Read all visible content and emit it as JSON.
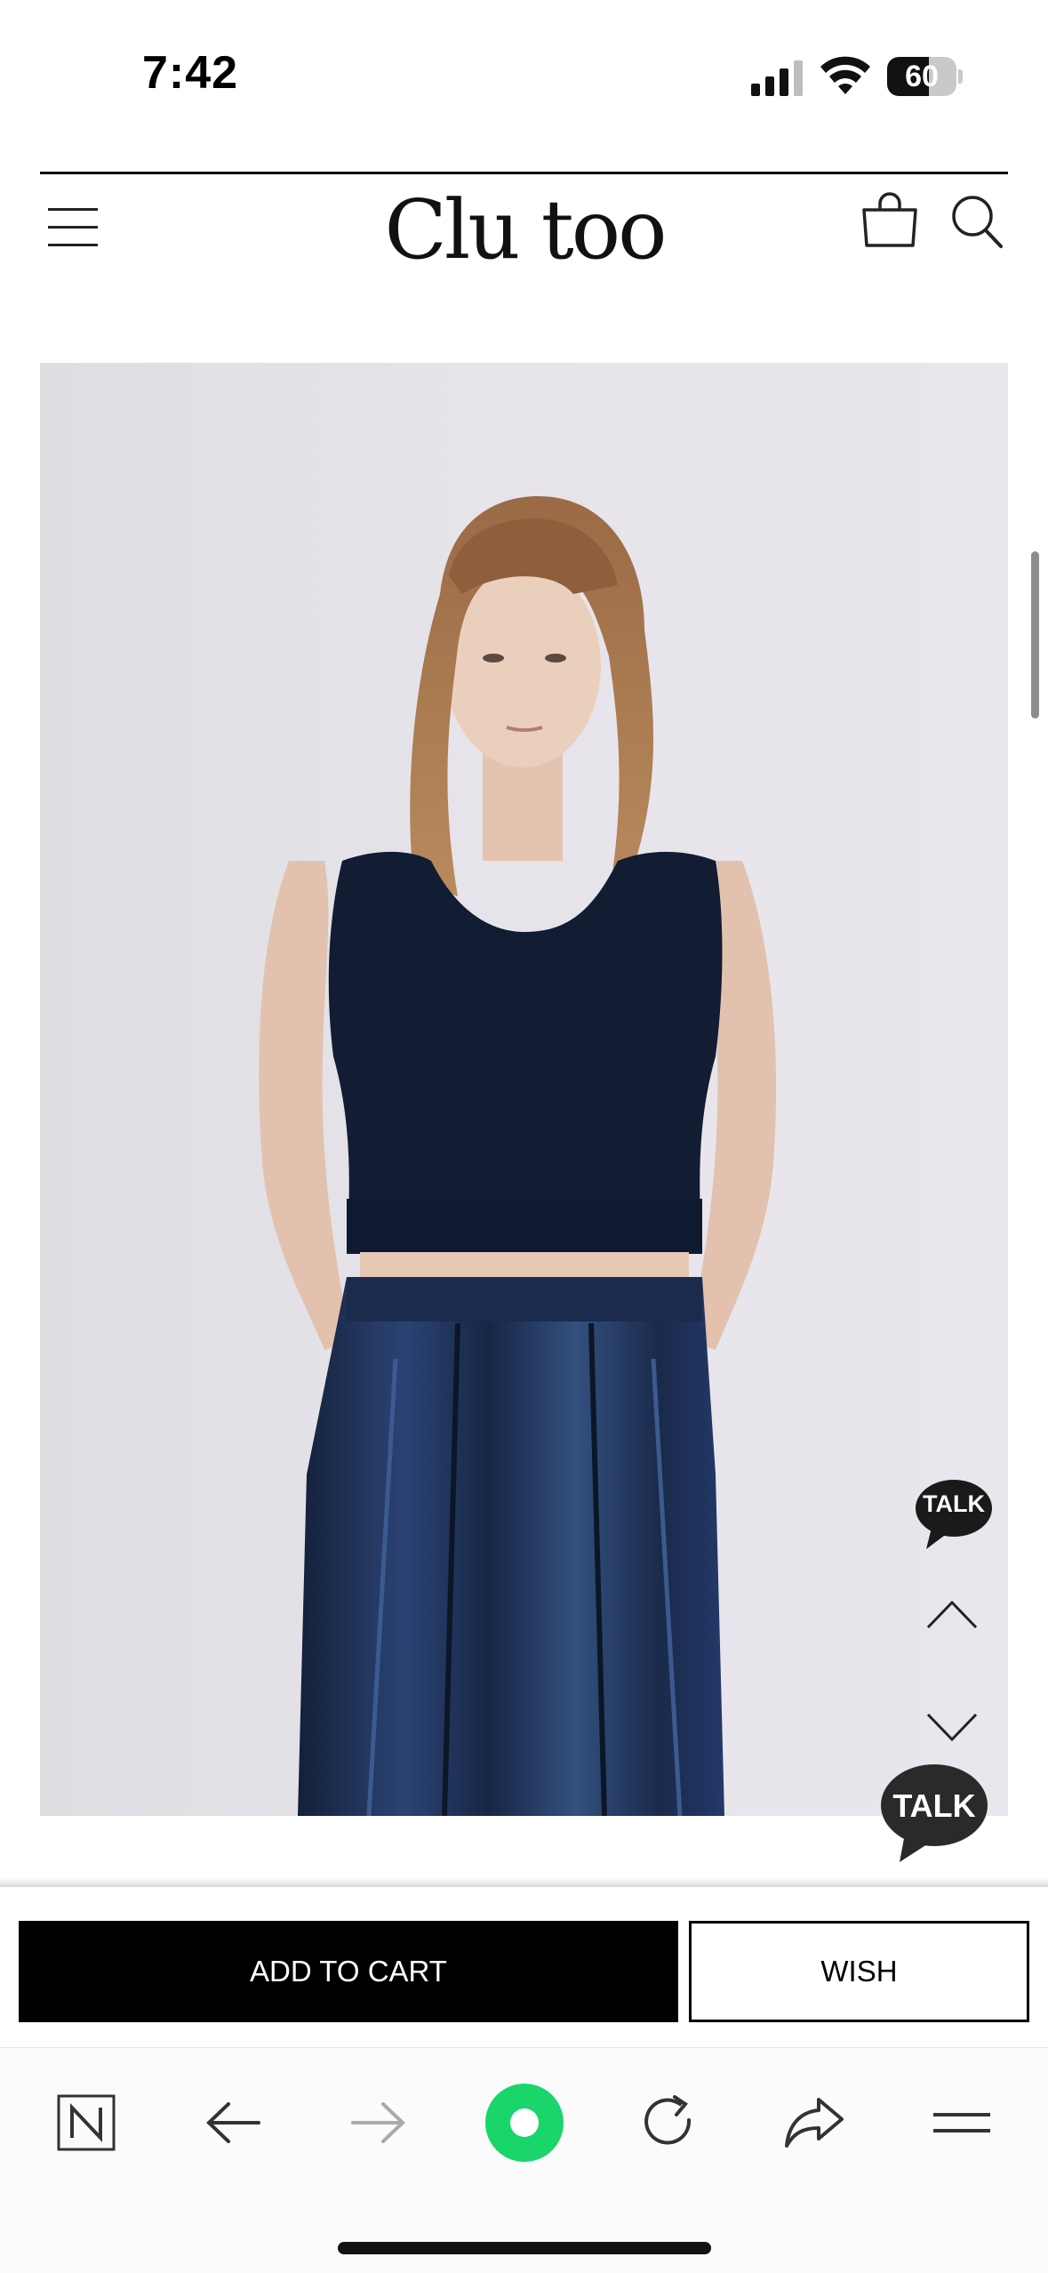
{
  "status_bar": {
    "time": "7:42",
    "battery_level": 60,
    "battery_text": "60",
    "icons": [
      "signal-icon",
      "wifi-icon",
      "battery-icon"
    ]
  },
  "header": {
    "brand": "Clu too",
    "icons": [
      "menu-icon",
      "shopping-bag-icon",
      "search-icon"
    ]
  },
  "product": {
    "image": "model-photo",
    "image_description_icon": "photo-model-navy-knit-vest-velvet-pants"
  },
  "floating": {
    "talk_small": "TALK",
    "talk_large": "TALK",
    "icons": [
      "chevron-up-icon",
      "chevron-down-icon"
    ]
  },
  "actions": {
    "add_to_cart": "ADD TO CART",
    "wish": "WISH"
  },
  "browser_toolbar": {
    "icons": [
      "naver-n-icon",
      "back-arrow-icon",
      "forward-arrow-icon",
      "green-home-icon",
      "refresh-icon",
      "share-icon",
      "menu-lines-icon"
    ]
  },
  "colors": {
    "primary": "#000000",
    "talk_bubble": "#1a1a1a",
    "green_button": "#19d56a",
    "navy": "#1c2a47"
  }
}
